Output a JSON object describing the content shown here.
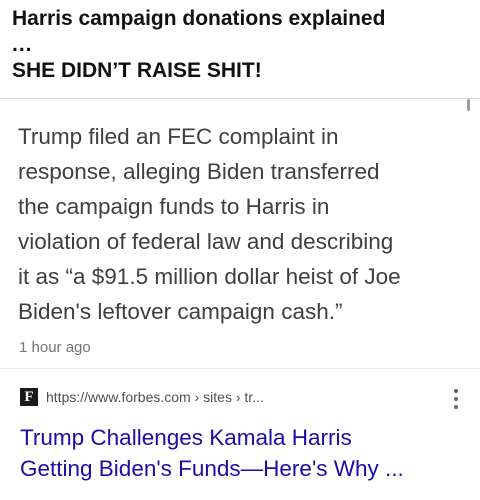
{
  "caption": {
    "line1": "Harris campaign donations explained",
    "ellipsis": "...",
    "line3": "SHE DIDN’T RAISE SHIT!"
  },
  "result": {
    "snippet_lines": [
      "Trump filed an FEC complaint in",
      "response, alleging Biden transferred",
      "the campaign funds to Harris in",
      "violation of federal law and describing",
      "it as “a $91.5 million dollar heist of Joe",
      "Biden's leftover campaign cash.”"
    ],
    "timestamp": "1 hour ago",
    "source": {
      "favicon_letter": "F",
      "url": "https://www.forbes.com › sites › tr..."
    },
    "more_icon": "more-vertical-icon",
    "title_lines": [
      "Trump Challenges Kamala Harris",
      "Getting Biden's Funds—Here's Why ..."
    ]
  },
  "colors": {
    "link": "#1a0dab",
    "snippet_text": "#3c4043",
    "meta_text": "#70757a",
    "caption_text": "#111111"
  }
}
